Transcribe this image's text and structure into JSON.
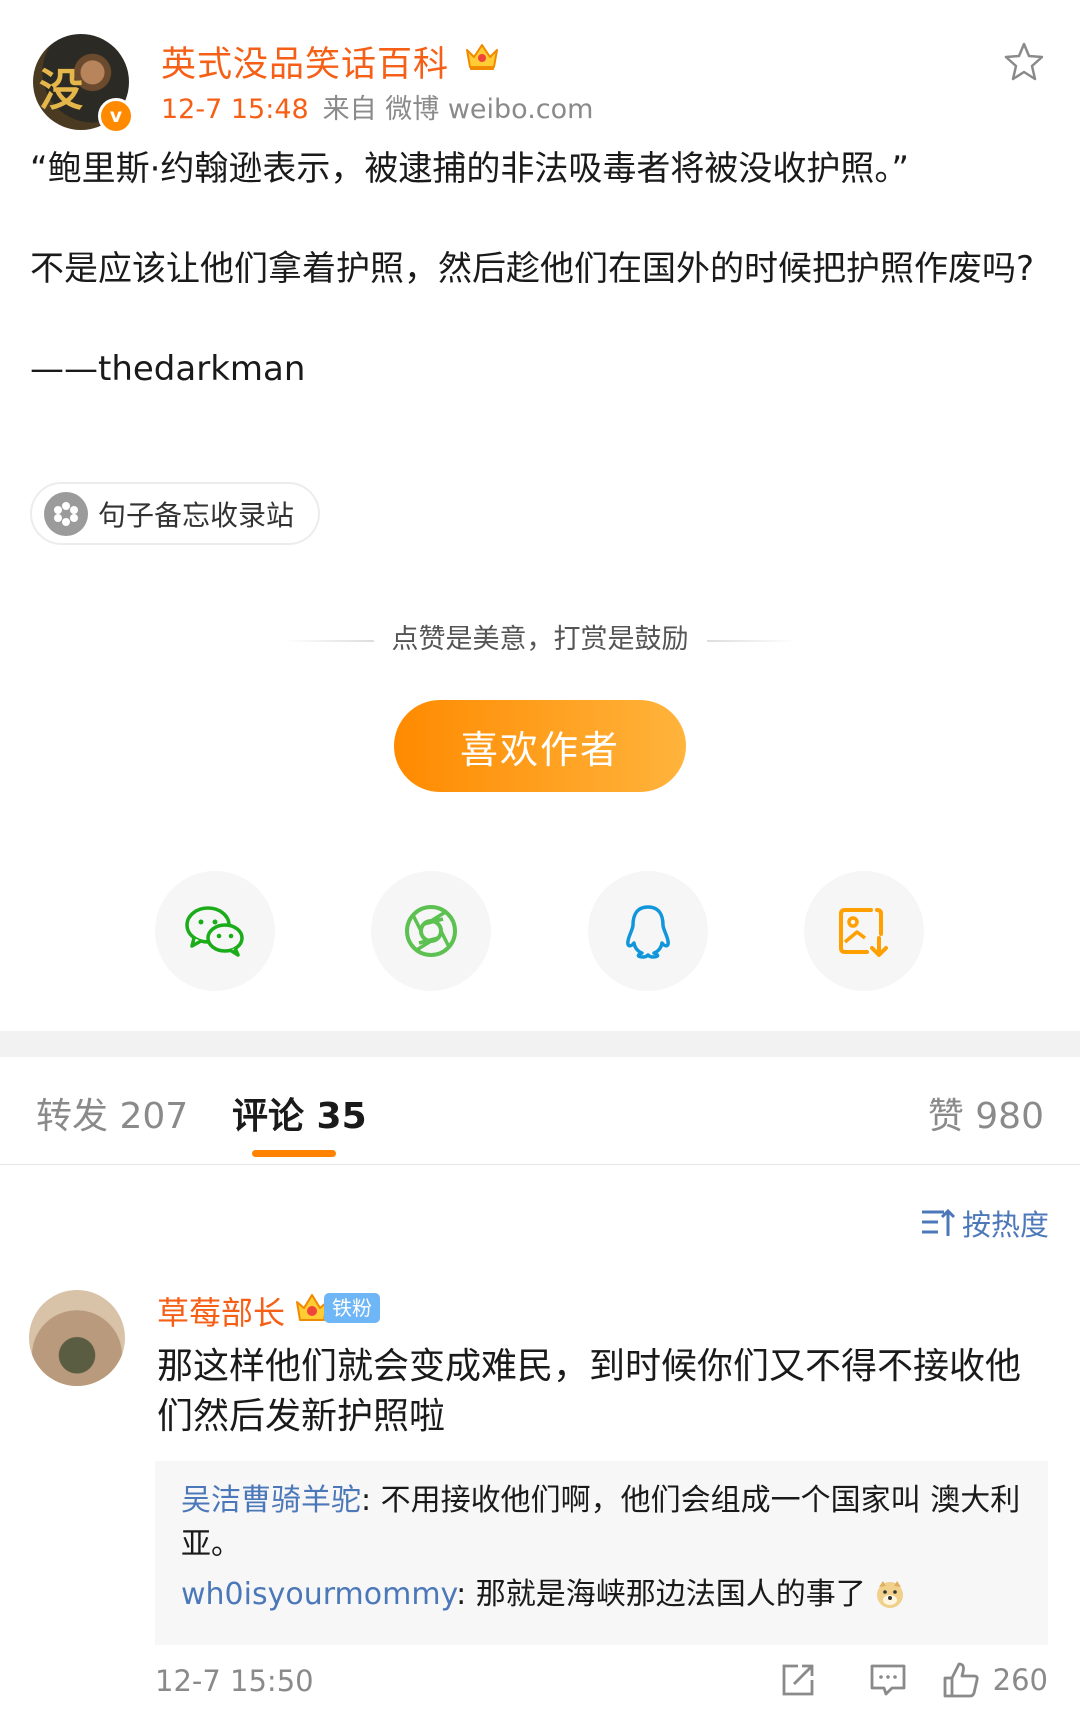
{
  "post": {
    "author_name": "英式没品笑话百科",
    "avatar_text": "没",
    "verified_mark": "v",
    "time": "12-7 15:48",
    "source": "来自 微博 weibo.com",
    "paragraphs": [
      "“鲍里斯·约翰逊表示，被逮捕的非法吸毒者将被没收护照。”",
      "不是应该让他们拿着护照，然后趁他们在国外的时候把护照作废吗?",
      "——thedarkman"
    ],
    "topic_chip": "句子备忘收录站"
  },
  "reward": {
    "tip": "点赞是美意，打赏是鼓励",
    "button_label": "喜欢作者"
  },
  "share": {
    "items": [
      "wechat-icon",
      "moments-icon",
      "qq-icon",
      "save-image-icon"
    ],
    "colors": {
      "wechat": "#1aad19",
      "moments": "#5cc150",
      "qq": "#1296db",
      "save": "#ff9f00"
    }
  },
  "tabs": {
    "repost": "转发 207",
    "comments": "评论 35",
    "likes": "赞 980"
  },
  "sort": {
    "label": "按热度"
  },
  "comment": {
    "user": "草莓部长",
    "badge_level": "6",
    "badge_label": "铁粉",
    "text": "那这样他们就会变成难民，到时候你们又不得不接收他们然后发新护照啦",
    "replies": [
      {
        "user": "吴洁曹骑羊驼",
        "sep": ": ",
        "text": "不用接收他们啊，他们会组成一个国家叫 澳大利亚。"
      },
      {
        "user": "wh0isyourmommy",
        "sep": ": ",
        "text": "那就是海峡那边法国人的事了"
      }
    ],
    "time": "12-7 15:50",
    "like_count": "260"
  },
  "colors": {
    "accent_orange": "#f55f16",
    "link_blue": "#4c78b9",
    "button_gradient_start": "#ff8a00",
    "button_gradient_end": "#ffb43c"
  }
}
